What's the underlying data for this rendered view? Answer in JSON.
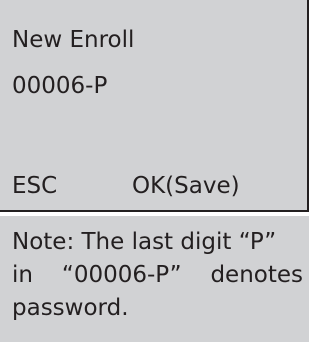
{
  "screen": {
    "title": "New Enroll",
    "user_id": "00006-P",
    "softkeys": {
      "esc_label": "ESC",
      "ok_label": "OK(Save)"
    }
  },
  "note": {
    "line1": "Note: The last digit “P”",
    "line2": "in “00006-P” denotes",
    "line3": "password."
  }
}
